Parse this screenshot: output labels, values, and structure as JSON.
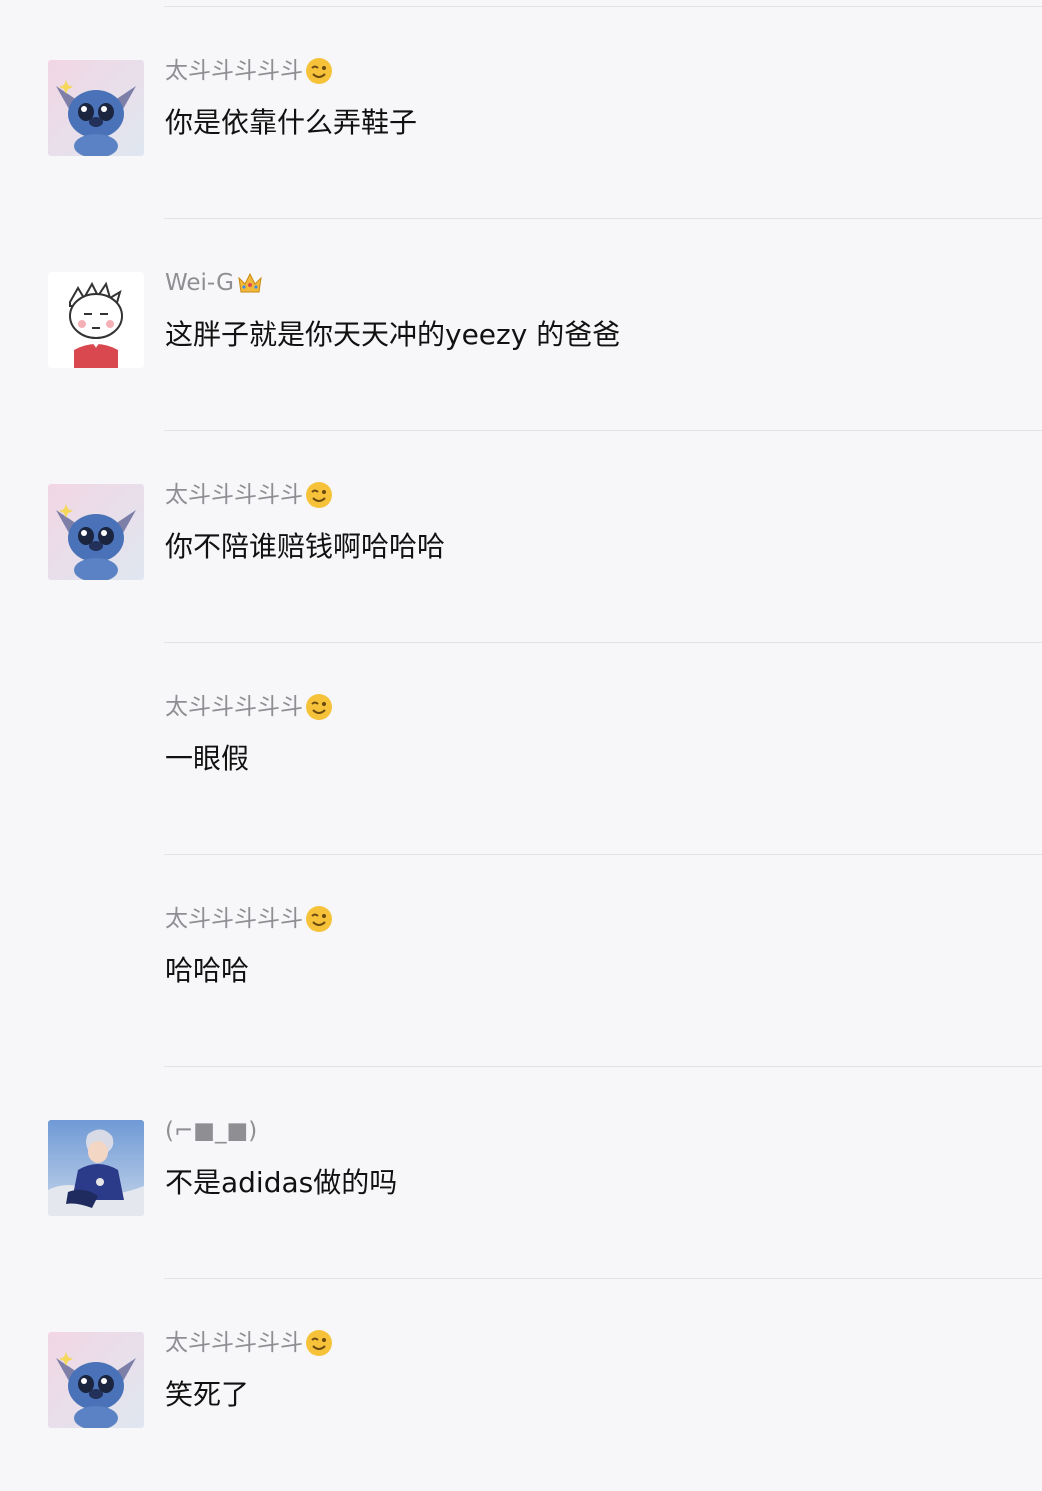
{
  "comments": [
    {
      "user": "太斗斗斗斗斗",
      "name_emoji": "wink-emoji",
      "avatar": "stitch-avatar",
      "text": "你是依靠什么弄鞋子"
    },
    {
      "user": "Wei-G",
      "name_emoji": "crown-emoji",
      "avatar": "cartoon-boy-avatar",
      "text": "这胖子就是你天天冲的yeezy 的爸爸"
    },
    {
      "user": "太斗斗斗斗斗",
      "name_emoji": "wink-emoji",
      "avatar": "stitch-avatar",
      "text": "你不陪谁赔钱啊哈哈哈"
    },
    {
      "user": "太斗斗斗斗斗",
      "name_emoji": "wink-emoji",
      "avatar": "",
      "text": "一眼假"
    },
    {
      "user": "太斗斗斗斗斗",
      "name_emoji": "wink-emoji",
      "avatar": "",
      "text": "哈哈哈"
    },
    {
      "user": "(⌐■_■)",
      "name_emoji": "",
      "avatar": "anime-character-avatar",
      "text": "不是adidas做的吗"
    },
    {
      "user": "太斗斗斗斗斗",
      "name_emoji": "wink-emoji",
      "avatar": "stitch-avatar",
      "text": "笑死了"
    }
  ],
  "colors": {
    "background": "#f7f7f9",
    "username": "#8e8e93",
    "comment_text": "#111111",
    "divider": "#e3e3e6"
  }
}
